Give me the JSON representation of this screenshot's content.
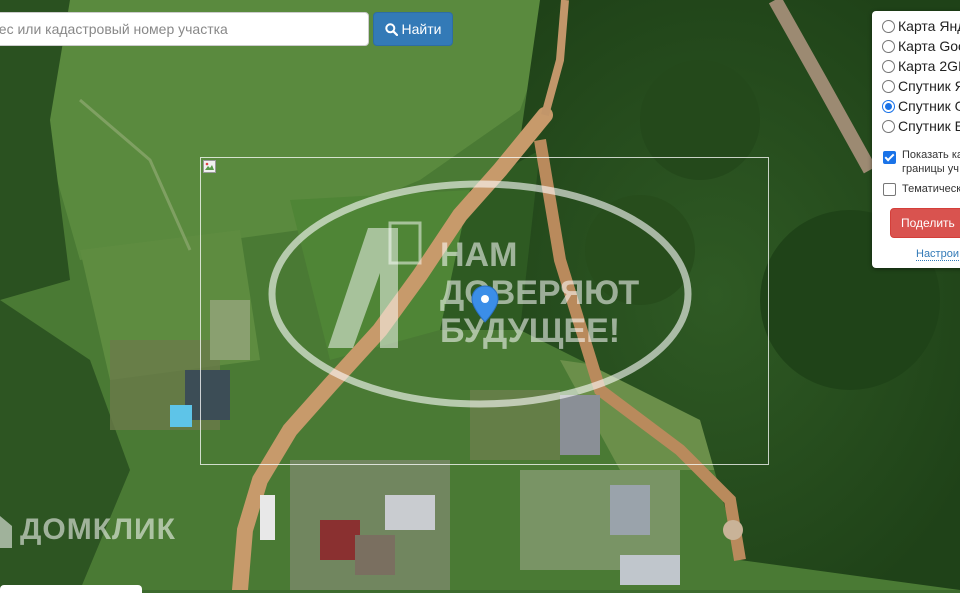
{
  "search": {
    "placeholder": "рес или кадастровый номер участка",
    "button_label": "Найти",
    "button_icon": "search-icon"
  },
  "layers": {
    "options": [
      {
        "label": "Карта Янд",
        "checked": false
      },
      {
        "label": "Карта Goo",
        "checked": false
      },
      {
        "label": "Карта 2GI",
        "checked": false
      },
      {
        "label": "Спутник Я",
        "checked": false
      },
      {
        "label": "Спутник G",
        "checked": true
      },
      {
        "label": "Спутник E",
        "checked": false
      }
    ],
    "show_boundaries_line1": "Показать ка",
    "show_boundaries_line2": "границы уч",
    "show_boundaries_checked": true,
    "thematic_label": "Тематическ",
    "thematic_checked": false,
    "share_label": "Поделить",
    "settings_label": "Настрои"
  },
  "watermark": {
    "line1": "НАМ",
    "line2": "ДОВЕРЯЮТ",
    "line3": "БУДУЩЕЕ!"
  },
  "brand": {
    "name": "ДОМКЛИК"
  },
  "colors": {
    "search_button": "#337ab7",
    "share_button": "#d9534f",
    "marker": "#3b8ee8",
    "radio_checked": "#1a73e8"
  }
}
